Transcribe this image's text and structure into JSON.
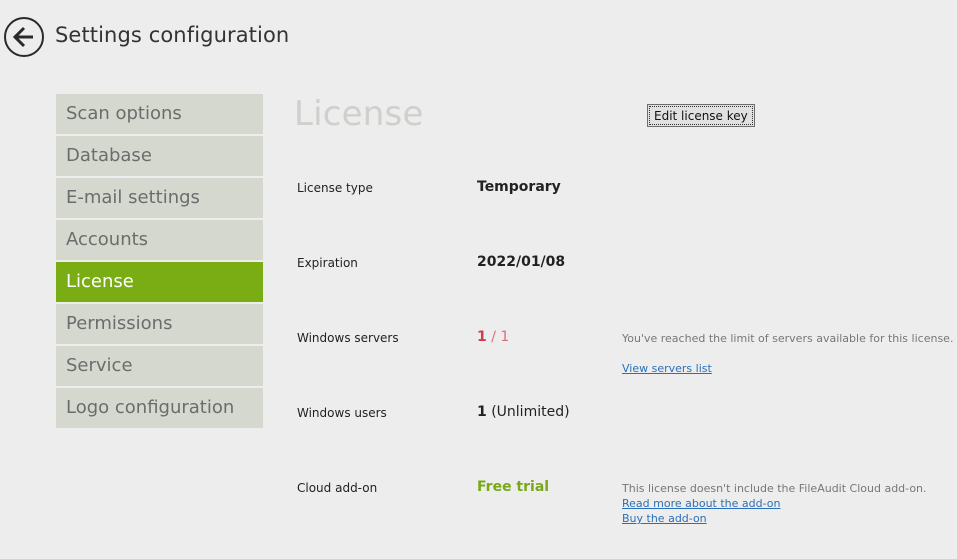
{
  "header": {
    "title": "Settings configuration",
    "back_icon": "back-arrow-icon"
  },
  "sidebar": {
    "items": [
      {
        "label": "Scan options",
        "active": false
      },
      {
        "label": "Database",
        "active": false
      },
      {
        "label": "E-mail settings",
        "active": false
      },
      {
        "label": "Accounts",
        "active": false
      },
      {
        "label": "License",
        "active": true
      },
      {
        "label": "Permissions",
        "active": false
      },
      {
        "label": "Service",
        "active": false
      },
      {
        "label": "Logo configuration",
        "active": false
      }
    ]
  },
  "content": {
    "title": "License",
    "edit_button_label": "Edit license key",
    "rows": {
      "license_type": {
        "label": "License type",
        "value": "Temporary"
      },
      "expiration": {
        "label": "Expiration",
        "value": "2022/01/08"
      },
      "windows_servers": {
        "label": "Windows servers",
        "used": "1",
        "separator": "/",
        "total": "1",
        "note": "You've reached the limit of servers available for this license.",
        "link": "View servers list"
      },
      "windows_users": {
        "label": "Windows users",
        "used": "1",
        "limit": "(Unlimited)"
      },
      "cloud_addon": {
        "label": "Cloud add-on",
        "value": "Free trial",
        "note": "This license doesn't include the FileAudit Cloud add-on.",
        "link_read_more": "Read more about the add-on",
        "link_buy": "Buy the add-on"
      }
    }
  },
  "colors": {
    "accent_green": "#7aac14",
    "sidebar_bg": "#d5d8cf",
    "limit_red": "#d23a4f",
    "link_blue": "#2a6fb8"
  }
}
